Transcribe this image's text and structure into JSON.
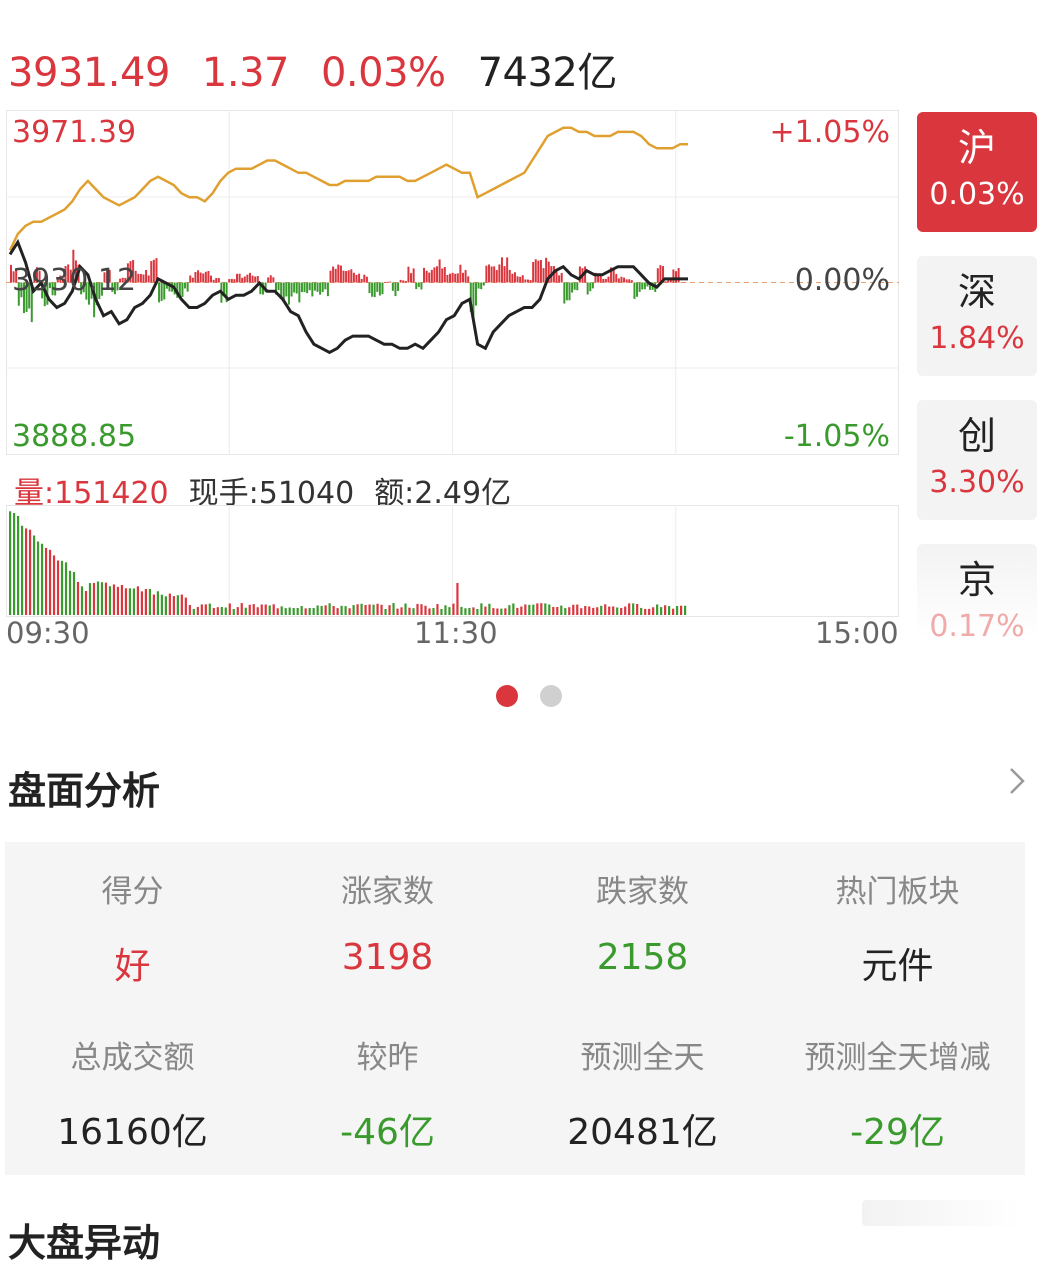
{
  "quote": {
    "price": "3931.49",
    "change": "1.37",
    "change_pct": "0.03%",
    "turnover": "7432亿"
  },
  "chart_labels": {
    "high": "3971.39",
    "high_pct": "+1.05%",
    "base": "3930.12",
    "base_pct": "0.00%",
    "low": "3888.85",
    "low_pct": "-1.05%"
  },
  "volume": {
    "liang": "量:151420",
    "xianshou": "现手:51040",
    "e": "额:2.49亿"
  },
  "times": [
    "09:30",
    "11:30",
    "15:00"
  ],
  "indices": [
    {
      "name": "沪",
      "pct": "0.03%"
    },
    {
      "name": "深",
      "pct": "1.84%"
    },
    {
      "name": "创",
      "pct": "3.30%"
    },
    {
      "name": "京",
      "pct": "0.17%"
    }
  ],
  "section": {
    "title": "盘面分析"
  },
  "stats": [
    {
      "label": "得分",
      "value": "好",
      "color": "#d9363e"
    },
    {
      "label": "涨家数",
      "value": "3198",
      "color": "#d9363e"
    },
    {
      "label": "跌家数",
      "value": "2158",
      "color": "#3a9a2e"
    },
    {
      "label": "热门板块",
      "value": "元件",
      "color": "#222222"
    },
    {
      "label": "总成交额",
      "value": "16160亿",
      "color": "#222222"
    },
    {
      "label": "较昨",
      "value": "-46亿",
      "color": "#3a9a2e"
    },
    {
      "label": "预测全天",
      "value": "20481亿",
      "color": "#222222"
    },
    {
      "label": "预测全天增减",
      "value": "-29亿",
      "color": "#3a9a2e"
    }
  ],
  "next_section": {
    "title": "大盘异动"
  },
  "colors": {
    "up": "#d9363e",
    "down": "#3a9a2e",
    "avg_line": "#e0a030",
    "price_line": "#222222"
  },
  "chart_data": {
    "type": "line",
    "ylim": [
      3888.85,
      3971.39
    ],
    "series": [
      {
        "values": [
          3937,
          3940,
          3935,
          3928,
          3930,
          3926,
          3924,
          3925,
          3928,
          3934,
          3932,
          3926,
          3922,
          3923,
          3920,
          3921,
          3924,
          3925,
          3927,
          3931,
          3930,
          3929,
          3926,
          3924,
          3924,
          3925,
          3927,
          3928,
          3926,
          3927,
          3927,
          3928,
          3930,
          3928,
          3928,
          3926,
          3923,
          3922,
          3918,
          3915,
          3914,
          3913,
          3914,
          3916,
          3917,
          3917,
          3917,
          3916,
          3915,
          3915,
          3914,
          3914,
          3915,
          3914,
          3916,
          3918,
          3921,
          3922,
          3925,
          3926,
          3915,
          3914,
          3918,
          3920,
          3922,
          3923,
          3924,
          3924,
          3926,
          3931,
          3933,
          3934,
          3932,
          3931,
          3933,
          3932,
          3932,
          3933,
          3934,
          3934,
          3934,
          3932,
          3930,
          3929,
          3931,
          3931,
          3931,
          3931
        ]
      },
      {
        "values": [
          3938,
          3942,
          3944,
          3945,
          3945,
          3946,
          3947,
          3948,
          3950,
          3953,
          3955,
          3953,
          3951,
          3950,
          3949,
          3950,
          3951,
          3953,
          3955,
          3956,
          3955,
          3954,
          3952,
          3951,
          3951,
          3950,
          3952,
          3955,
          3957,
          3958,
          3958,
          3958,
          3959,
          3960,
          3960,
          3959,
          3958,
          3957,
          3957,
          3956,
          3955,
          3954,
          3954,
          3955,
          3955,
          3955,
          3955,
          3956,
          3956,
          3956,
          3956,
          3955,
          3955,
          3956,
          3957,
          3958,
          3959,
          3958,
          3957,
          3957,
          3951,
          3952,
          3953,
          3954,
          3955,
          3956,
          3957,
          3960,
          3963,
          3966,
          3967,
          3968,
          3968,
          3967,
          3967,
          3966,
          3966,
          3966,
          3967,
          3967,
          3967,
          3966,
          3964,
          3963,
          3963,
          3963,
          3964,
          3964
        ]
      }
    ]
  }
}
